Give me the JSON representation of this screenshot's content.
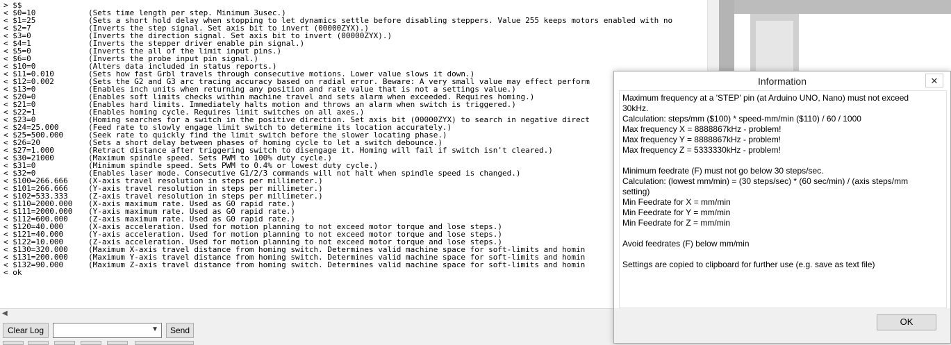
{
  "console": {
    "lines": [
      [
        "> $$",
        ""
      ],
      [
        "< $0=10",
        "(Sets time length per step. Minimum 3usec.)"
      ],
      [
        "< $1=25",
        "(Sets a short hold delay when stopping to let dynamics settle before disabling steppers. Value 255 keeps motors enabled with no"
      ],
      [
        "< $2=7",
        "(Inverts the step signal. Set axis bit to invert (00000ZYX).)"
      ],
      [
        "< $3=0",
        "(Inverts the direction signal. Set axis bit to invert (00000ZYX).)"
      ],
      [
        "< $4=1",
        "(Inverts the stepper driver enable pin signal.)"
      ],
      [
        "< $5=0",
        "(Inverts the all of the limit input pins.)"
      ],
      [
        "< $6=0",
        "(Inverts the probe input pin signal.)"
      ],
      [
        "< $10=0",
        "(Alters data included in status reports.)"
      ],
      [
        "< $11=0.010",
        "(Sets how fast Grbl travels through consecutive motions. Lower value slows it down.)"
      ],
      [
        "< $12=0.002",
        "(Sets the G2 and G3 arc tracing accuracy based on radial error. Beware: A very small value may effect perform"
      ],
      [
        "< $13=0",
        "(Enables inch units when returning any position and rate value that is not a settings value.)"
      ],
      [
        "< $20=0",
        "(Enables soft limits checks within machine travel and sets alarm when exceeded. Requires homing.)"
      ],
      [
        "< $21=0",
        "(Enables hard limits. Immediately halts motion and throws an alarm when switch is triggered.)"
      ],
      [
        "< $22=1",
        "(Enables homing cycle. Requires limit switches on all axes.)"
      ],
      [
        "< $23=0",
        "(Homing searches for a switch in the positive direction. Set axis bit (00000ZYX) to search in negative direct"
      ],
      [
        "< $24=25.000",
        "(Feed rate to slowly engage limit switch to determine its location accurately.)"
      ],
      [
        "< $25=500.000",
        "(Seek rate to quickly find the limit switch before the slower locating phase.)"
      ],
      [
        "< $26=20",
        "(Sets a short delay between phases of homing cycle to let a switch debounce.)"
      ],
      [
        "< $27=1.000",
        "(Retract distance after triggering switch to disengage it. Homing will fail if switch isn't cleared.)"
      ],
      [
        "< $30=21000",
        "(Maximum spindle speed. Sets PWM to 100% duty cycle.)"
      ],
      [
        "< $31=0",
        "(Minimum spindle speed. Sets PWM to 0.4% or lowest duty cycle.)"
      ],
      [
        "< $32=0",
        "(Enables laser mode. Consecutive G1/2/3 commands will not halt when spindle speed is changed.)"
      ],
      [
        "< $100=266.666",
        "(X-axis travel resolution in steps per millimeter.)"
      ],
      [
        "< $101=266.666",
        "(Y-axis travel resolution in steps per millimeter.)"
      ],
      [
        "< $102=533.333",
        "(Z-axis travel resolution in steps per millimeter.)"
      ],
      [
        "< $110=2000.000",
        "(X-axis maximum rate. Used as G0 rapid rate.)"
      ],
      [
        "< $111=2000.000",
        "(Y-axis maximum rate. Used as G0 rapid rate.)"
      ],
      [
        "< $112=600.000",
        "(Z-axis maximum rate. Used as G0 rapid rate.)"
      ],
      [
        "< $120=40.000",
        "(X-axis acceleration. Used for motion planning to not exceed motor torque and lose steps.)"
      ],
      [
        "< $121=40.000",
        "(Y-axis acceleration. Used for motion planning to not exceed motor torque and lose steps.)"
      ],
      [
        "< $122=10.000",
        "(Z-axis acceleration. Used for motion planning to not exceed motor torque and lose steps.)"
      ],
      [
        "< $130=320.000",
        "(Maximum X-axis travel distance from homing switch. Determines valid machine space for soft-limits and homin"
      ],
      [
        "< $131=200.000",
        "(Maximum Y-axis travel distance from homing switch. Determines valid machine space for soft-limits and homin"
      ],
      [
        "< $132=90.000",
        "(Maximum Z-axis travel distance from homing switch. Determines valid machine space for soft-limits and homin"
      ],
      [
        "< ok",
        ""
      ]
    ]
  },
  "controls": {
    "clear_log": "Clear Log",
    "command_value": "",
    "send": "Send"
  },
  "dialog": {
    "title": "Information",
    "close_glyph": "✕",
    "paragraphs": [
      [
        "Maximum frequency at a 'STEP' pin (at Arduino UNO, Nano) must not exceed 30kHz.",
        "Calculation: steps/mm ($100) * speed-mm/min ($110) / 60 / 1000",
        "Max frequency X = 8888867kHz - problem!",
        "Max frequency Y = 8888867kHz - problem!",
        "Max frequency Z = 5333330kHz - problem!"
      ],
      [
        "Minimum feedrate (F) must not go below 30 steps/sec.",
        "Calculation: (lowest mm/min) = (30 steps/sec) * (60 sec/min) / (axis steps/mm setting)",
        "Min Feedrate for X =  mm/min",
        "Min Feedrate for Y =  mm/min",
        "Min Feedrate for Z =  mm/min"
      ],
      [
        "Avoid feedrates (F) below  mm/min"
      ],
      [
        "Settings are copied to clipboard for further use (e.g. save as text file)"
      ]
    ],
    "ok": "OK"
  },
  "icons": {
    "combo_arrow": "chevron-down-icon",
    "scroll_left": "scroll-left-arrow-icon",
    "close": "close-icon"
  },
  "colors": {
    "dialog_bg": "#ffffff",
    "footer_bg": "#f0f0f0",
    "console_bg": "#ffffff"
  }
}
